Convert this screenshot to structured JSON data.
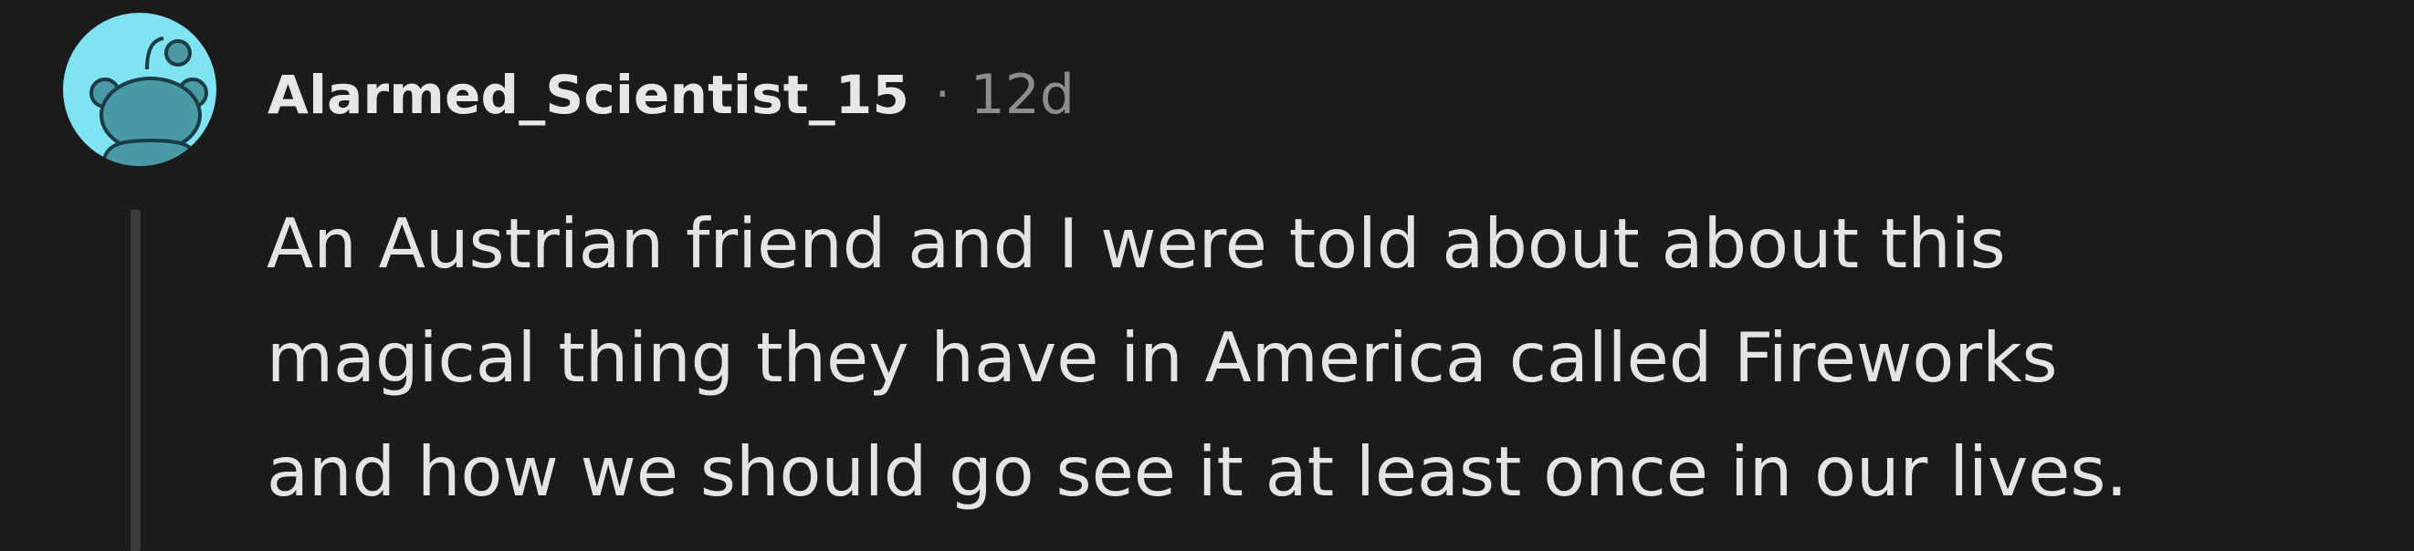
{
  "comment": {
    "author": "Alarmed_Scientist_15",
    "separator": "·",
    "age": "12d",
    "avatar_icon": "snoo-avatar-icon",
    "avatar_color": "#7fe3f2",
    "body_lines": [
      "An Austrian friend and I were told about about this",
      "magical thing they have in America called Fireworks",
      "and how we should go see it at least once in our lives."
    ]
  }
}
